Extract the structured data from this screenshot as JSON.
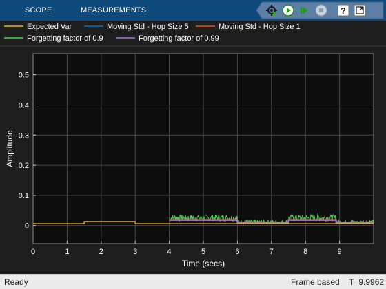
{
  "toolbar": {
    "tabs": [
      "SCOPE",
      "MEASUREMENTS"
    ],
    "buttons": [
      {
        "name": "run-settings-icon",
        "icon": "gear-play"
      },
      {
        "name": "run-icon",
        "icon": "play"
      },
      {
        "name": "step-forward-icon",
        "icon": "step-forward"
      },
      {
        "name": "stop-icon",
        "icon": "stop"
      },
      {
        "name": "help-icon",
        "icon": "question"
      },
      {
        "name": "undock-icon",
        "icon": "undock"
      }
    ]
  },
  "legend_rows": [
    [
      "Expected Var",
      "Moving Std - Hop Size 5",
      "Moving Std - Hop Size 1"
    ],
    [
      "Forgetting factor of 0.9",
      "Forgetting factor of 0.99"
    ]
  ],
  "chart_data": {
    "type": "line",
    "xlabel": "Time (secs)",
    "ylabel": "Amplitude",
    "xlim": [
      0,
      10
    ],
    "ylim": [
      -0.06,
      0.57
    ],
    "xticks": [
      0,
      1,
      2,
      3,
      4,
      5,
      6,
      7,
      8,
      9
    ],
    "yticks": [
      0,
      0.1,
      0.2,
      0.3,
      0.4,
      0.5
    ],
    "ytick_labels": [
      "0",
      "0.1",
      "0.2",
      "0.3",
      "0.4",
      "0.5"
    ],
    "grid": true,
    "legend_position": "top",
    "series": [
      {
        "name": "Expected Var",
        "color": "#edb120",
        "x": [
          0,
          1.5,
          1.5,
          3,
          3,
          10
        ],
        "y": [
          0.006,
          0.006,
          0.013,
          0.013,
          0.006,
          0.006
        ]
      },
      {
        "name": "Moving Std - Hop Size 5",
        "color": "#0072bd",
        "x": [
          4,
          6,
          6,
          7.5,
          7.5,
          8.9,
          8.9,
          10
        ],
        "y": [
          0.02,
          0.02,
          0.01,
          0.01,
          0.02,
          0.02,
          0.01,
          0.01
        ]
      },
      {
        "name": "Moving Std - Hop Size 1",
        "color": "#d95319",
        "x": [
          4,
          6,
          6,
          7.5,
          7.5,
          8.9,
          8.9,
          10
        ],
        "y": [
          0.02,
          0.02,
          0.01,
          0.01,
          0.02,
          0.02,
          0.01,
          0.01
        ]
      },
      {
        "name": "Forgetting factor of 0.9",
        "color": "#4cd44c",
        "segments": [
          {
            "x": [
              4,
              6
            ],
            "base": 0.022,
            "amp": 0.022
          },
          {
            "x": [
              6,
              7.5
            ],
            "base": 0.01,
            "amp": 0.012
          },
          {
            "x": [
              7.5,
              8.9
            ],
            "base": 0.022,
            "amp": 0.022
          },
          {
            "x": [
              8.9,
              10
            ],
            "base": 0.01,
            "amp": 0.012
          }
        ]
      },
      {
        "name": "Forgetting factor of 0.99",
        "color": "#a07bd4",
        "x": [
          4,
          6,
          6,
          7.5,
          7.5,
          8.9,
          8.9,
          10
        ],
        "y": [
          0.018,
          0.018,
          0.009,
          0.009,
          0.018,
          0.018,
          0.009,
          0.009
        ]
      }
    ]
  },
  "status": {
    "left": "Ready",
    "mode": "Frame based",
    "time": "T=9.9962"
  }
}
